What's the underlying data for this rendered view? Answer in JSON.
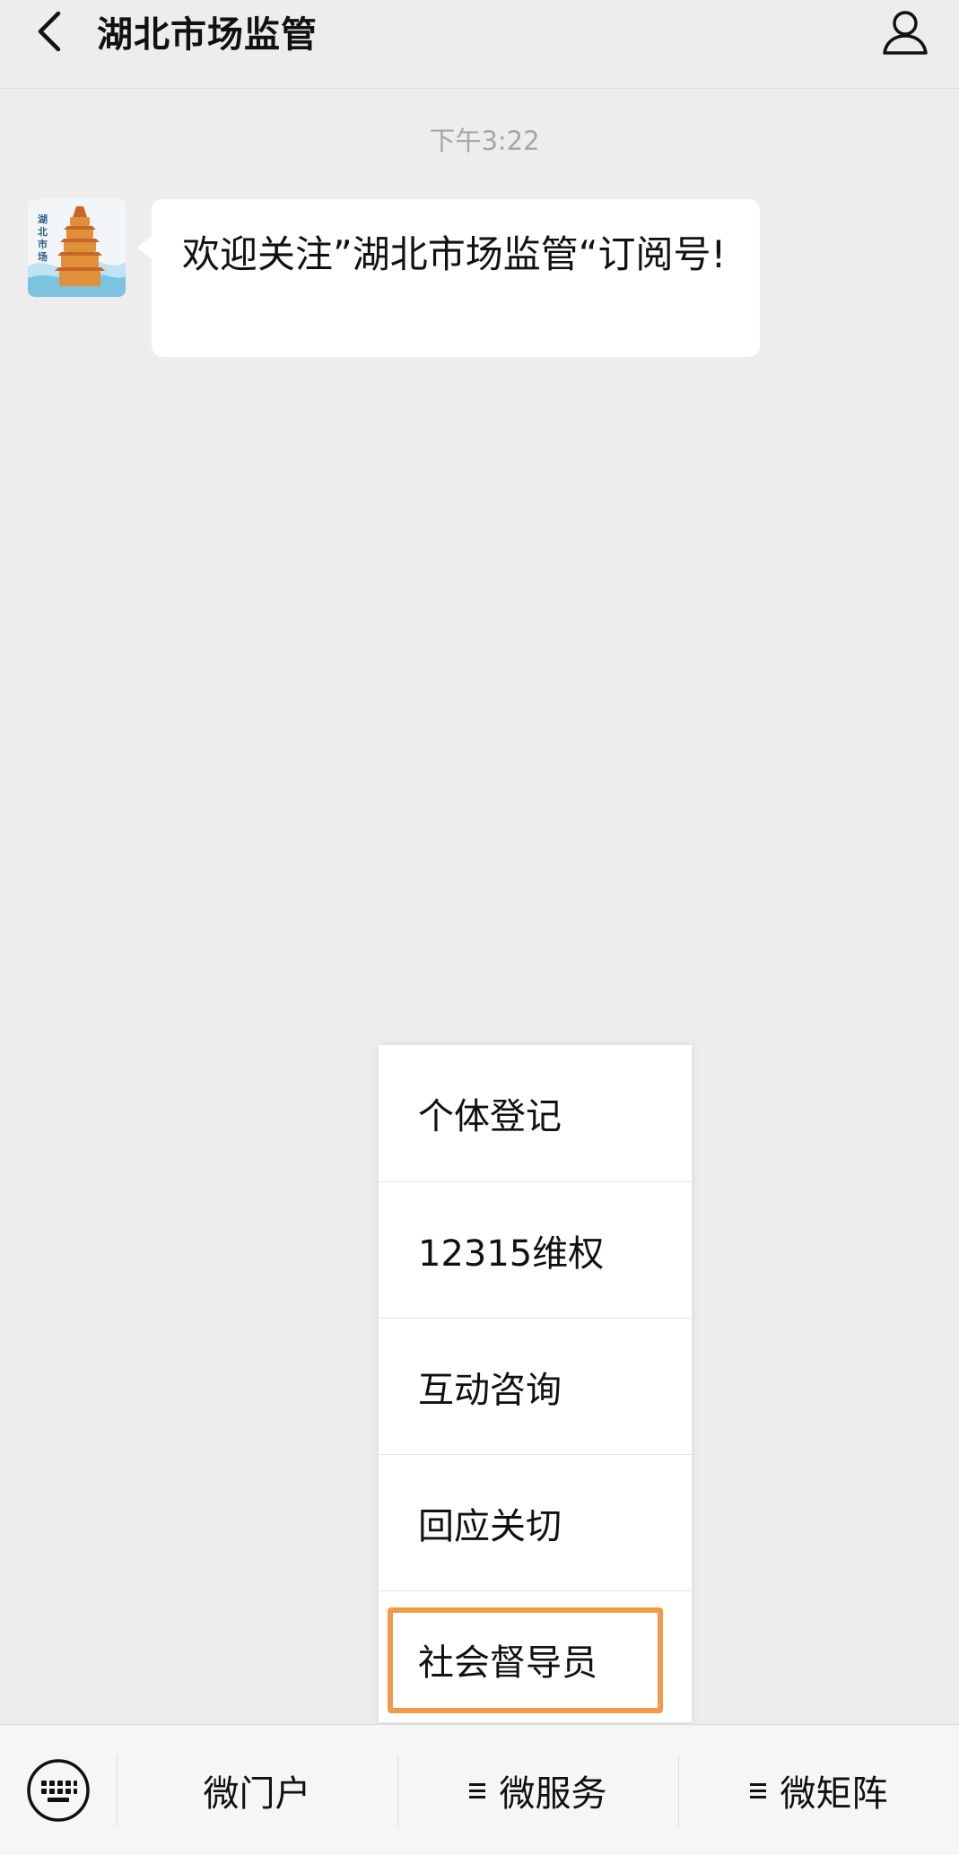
{
  "header": {
    "title": "湖北市场监管",
    "back_icon": "chevron-left-icon",
    "profile_icon": "person-icon"
  },
  "chat": {
    "timestamp": "下午3:22",
    "message": "欢迎关注”湖北市场监管“订阅号!",
    "avatar_text": "湖北市场监管"
  },
  "popup_menu": {
    "items": [
      {
        "label": "个体登记",
        "highlighted": false
      },
      {
        "label": "12315维权",
        "highlighted": false
      },
      {
        "label": "互动咨询",
        "highlighted": false
      },
      {
        "label": "回应关切",
        "highlighted": false
      },
      {
        "label": "社会督导员",
        "highlighted": true
      }
    ],
    "highlight_color": "#f29a4a"
  },
  "bottom_bar": {
    "keyboard_icon": "keyboard-icon",
    "tabs": [
      {
        "label": "微门户",
        "has_submenu": false
      },
      {
        "label": "微服务",
        "has_submenu": true
      },
      {
        "label": "微矩阵",
        "has_submenu": true
      }
    ]
  }
}
